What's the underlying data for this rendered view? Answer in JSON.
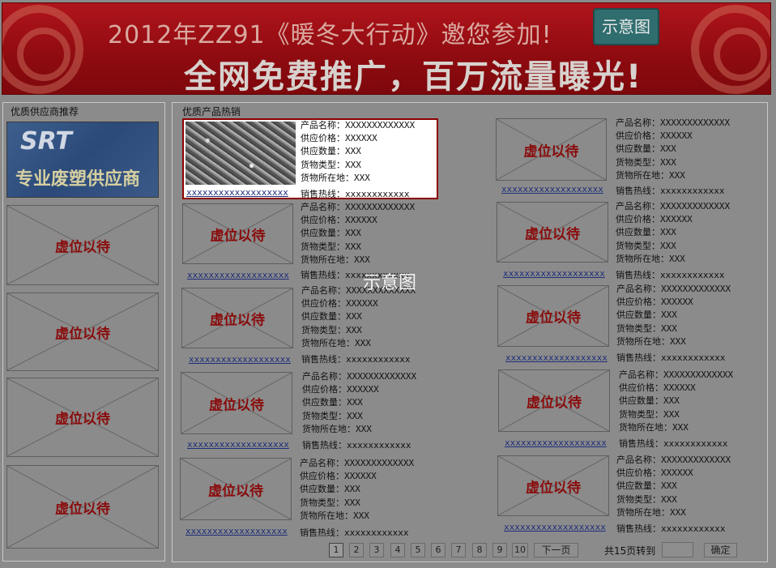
{
  "banner": {
    "line1": "2012年ZZ91《暖冬大行动》邀您参加!",
    "line2": "全网免费推广，百万流量曝光!",
    "badge": "示意图"
  },
  "left_panel": {
    "title": "优质供应商推荐",
    "ad_logo": "SRT",
    "ad_slogan": "专业废塑供应商",
    "placeholder_text": "虚位以待"
  },
  "right_panel": {
    "title": "优质产品热销"
  },
  "overlay_label": "示意图",
  "product_placeholder_text": "虚位以待",
  "products": [
    {
      "name": "产品名称：XXXXXXXXXXXXX",
      "price": "供应价格：XXXXXX",
      "qty": "供应数量：XXX",
      "type": "货物类型：XXX",
      "loc": "货物所在地：XXX",
      "link": "xxxxxxxxxxxxxxxxxxx",
      "hotline": "销售热线：xxxxxxxxxxxx"
    },
    {
      "name": "产品名称：XXXXXXXXXXXXX",
      "price": "供应价格：XXXXXX",
      "qty": "供应数量：XXX",
      "type": "货物类型：XXX",
      "loc": "货物所在地：XXX",
      "link": "xxxxxxxxxxxxxxxxxxx",
      "hotline": "销售热线：xxxxxxxxxxxx"
    },
    {
      "name": "产品名称：XXXXXXXXXXXXX",
      "price": "供应价格：XXXXXX",
      "qty": "供应数量：XXX",
      "type": "货物类型：XXX",
      "loc": "货物所在地：XXX",
      "link": "xxxxxxxxxxxxxxxxxxx",
      "hotline": "销售热线：xxxxxxxxxxxx"
    },
    {
      "name": "产品名称：XXXXXXXXXXXXX",
      "price": "供应价格：XXXXXX",
      "qty": "供应数量：XXX",
      "type": "货物类型：XXX",
      "loc": "货物所在地：XXX",
      "link": "xxxxxxxxxxxxxxxxxxx",
      "hotline": "销售热线：xxxxxxxxxxxx"
    },
    {
      "name": "产品名称：XXXXXXXXXXXXX",
      "price": "供应价格：XXXXXX",
      "qty": "供应数量：XXX",
      "type": "货物类型：XXX",
      "loc": "货物所在地：XXX",
      "link": "xxxxxxxxxxxxxxxxxxx",
      "hotline": "销售热线：xxxxxxxxxxxx"
    },
    {
      "name": "产品名称：XXXXXXXXXXXXX",
      "price": "供应价格：XXXXXX",
      "qty": "供应数量：XXX",
      "type": "货物类型：XXX",
      "loc": "货物所在地：XXX",
      "link": "xxxxxxxxxxxxxxxxxxx",
      "hotline": "销售热线：xxxxxxxxxxxx"
    },
    {
      "name": "产品名称：XXXXXXXXXXXXX",
      "price": "供应价格：XXXXXX",
      "qty": "供应数量：XXX",
      "type": "货物类型：XXX",
      "loc": "货物所在地：XXX",
      "link": "xxxxxxxxxxxxxxxxxxx",
      "hotline": "销售热线：xxxxxxxxxxxx"
    },
    {
      "name": "产品名称：XXXXXXXXXXXXX",
      "price": "供应价格：XXXXXX",
      "qty": "供应数量：XXX",
      "type": "货物类型：XXX",
      "loc": "货物所在地：XXX",
      "link": "xxxxxxxxxxxxxxxxxxx",
      "hotline": "销售热线：xxxxxxxxxxxx"
    },
    {
      "name": "产品名称：XXXXXXXXXXXXX",
      "price": "供应价格：XXXXXX",
      "qty": "供应数量：XXX",
      "type": "货物类型：XXX",
      "loc": "货物所在地：XXX",
      "link": "xxxxxxxxxxxxxxxxxxx",
      "hotline": "销售热线：xxxxxxxxxxxx"
    },
    {
      "name": "产品名称：XXXXXXXXXXXXX",
      "price": "供应价格：XXXXXX",
      "qty": "供应数量：XXX",
      "type": "货物类型：XXX",
      "loc": "货物所在地：XXX",
      "link": "xxxxxxxxxxxxxxxxxxx",
      "hotline": "销售热线：xxxxxxxxxxxx"
    }
  ],
  "pager": {
    "pages": [
      "1",
      "2",
      "3",
      "4",
      "5",
      "6",
      "7",
      "8",
      "9",
      "10"
    ],
    "current": "1",
    "next": "下一页",
    "goto_text": "共15页转到",
    "confirm": "确定"
  }
}
